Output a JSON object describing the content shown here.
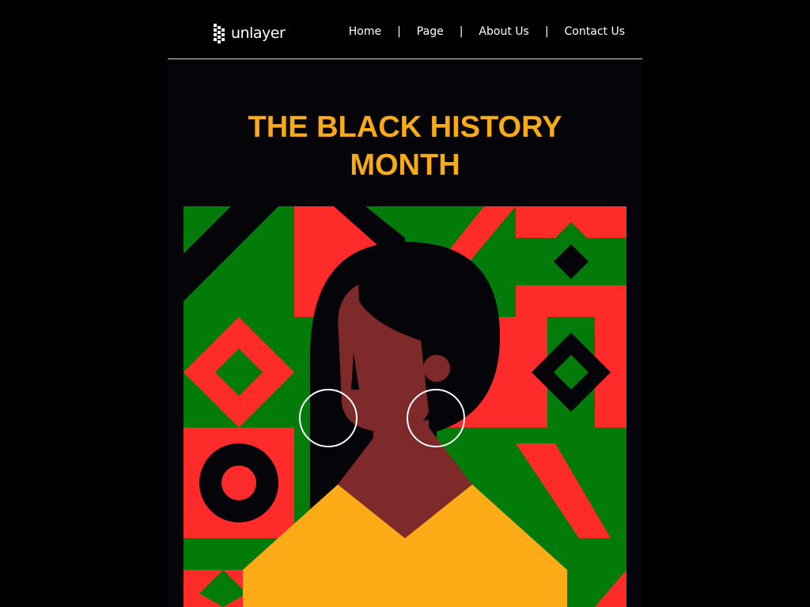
{
  "header": {
    "logo_text": "unlayer",
    "logo_icon": "unlayer-logo-mark",
    "nav": [
      {
        "label": "Home"
      },
      {
        "label": "Page"
      },
      {
        "label": "About Us"
      },
      {
        "label": "Contact Us"
      }
    ],
    "separator": "|"
  },
  "hero": {
    "title_line1": "THE BLACK HISTORY",
    "title_line2": "MONTH",
    "illustration": "woman-portrait-geometric-pattern-illustration"
  },
  "colors": {
    "background": "#000000",
    "title": "#f9aa18",
    "green": "#027b0b",
    "red": "#ff2a2a",
    "black": "#050509",
    "skin": "#7f2a2a",
    "yellow": "#fdab17"
  }
}
